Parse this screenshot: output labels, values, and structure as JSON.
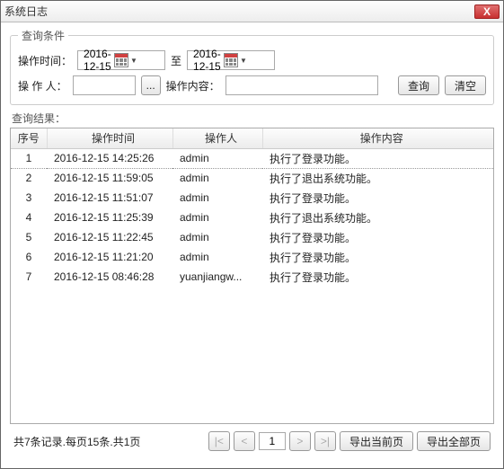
{
  "window": {
    "title": "系统日志",
    "close": "X"
  },
  "query": {
    "legend": "查询条件",
    "timeLabel": "操作时间：",
    "toLabel": "至",
    "dateFrom": "2016-12-15",
    "dateTo": "2016-12-15",
    "operatorLabel": "操 作 人：",
    "operatorValue": "",
    "browseLabel": "...",
    "contentLabel": "操作内容：",
    "contentValue": "",
    "searchLabel": "查询",
    "clearLabel": "清空"
  },
  "result": {
    "label": "查询结果：",
    "headers": {
      "seq": "序号",
      "time": "操作时间",
      "oper": "操作人",
      "cont": "操作内容"
    },
    "rows": [
      {
        "seq": "1",
        "time": "2016-12-15 14:25:26",
        "oper": "admin",
        "cont": "执行了登录功能。"
      },
      {
        "seq": "2",
        "time": "2016-12-15 11:59:05",
        "oper": "admin",
        "cont": "执行了退出系统功能。"
      },
      {
        "seq": "3",
        "time": "2016-12-15 11:51:07",
        "oper": "admin",
        "cont": "执行了登录功能。"
      },
      {
        "seq": "4",
        "time": "2016-12-15 11:25:39",
        "oper": "admin",
        "cont": "执行了退出系统功能。"
      },
      {
        "seq": "5",
        "time": "2016-12-15 11:22:45",
        "oper": "admin",
        "cont": "执行了登录功能。"
      },
      {
        "seq": "6",
        "time": "2016-12-15 11:21:20",
        "oper": "admin",
        "cont": "执行了登录功能。"
      },
      {
        "seq": "7",
        "time": "2016-12-15 08:46:28",
        "oper": "yuanjiangw...",
        "cont": "执行了登录功能。"
      }
    ]
  },
  "footer": {
    "status": "共7条记录.每页15条.共1页",
    "first": "|<",
    "prev": "<",
    "page": "1",
    "next": ">",
    "last": ">|",
    "exportPage": "导出当前页",
    "exportAll": "导出全部页"
  }
}
